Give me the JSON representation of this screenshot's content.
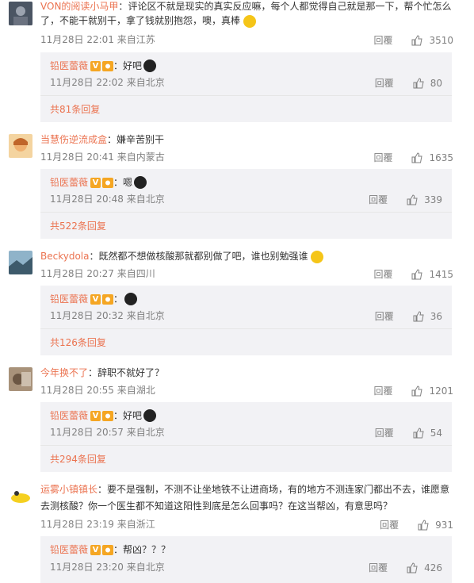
{
  "comments": [
    {
      "username": "VON的阅读小马甲",
      "text_line1": "评论区不就是现实的真实反应嘛，每个人都觉得自己就是那一下，帮个忙怎么",
      "text_line2": "了，不能干就别干，拿了钱就别抱怨，噢，真棒",
      "time": "11月28日 22:01 来自江苏",
      "reply_label": "回覆",
      "likes": "3510",
      "reply": {
        "username": "铅医蕾薇",
        "text": "好吧",
        "time": "11月28日 22:02 来自北京",
        "reply_label": "回覆",
        "likes": "80"
      },
      "more": "共81条回复"
    },
    {
      "username": "当慧伤逆流成盒",
      "text_line1": "嫌辛苦别干",
      "time": "11月28日 20:41 来自内蒙古",
      "reply_label": "回覆",
      "likes": "1635",
      "reply": {
        "username": "铅医蕾薇",
        "text": "嗯",
        "time": "11月28日 20:48 来自北京",
        "reply_label": "回覆",
        "likes": "339"
      },
      "more": "共522条回复"
    },
    {
      "username": "Beckydola",
      "text_line1": "既然都不想做核酸那就都别做了吧，谁也别勉强谁",
      "time": "11月28日 20:27 来自四川",
      "reply_label": "回覆",
      "likes": "1415",
      "reply": {
        "username": "铅医蕾薇",
        "text": "",
        "time": "11月28日 20:32 来自北京",
        "reply_label": "回覆",
        "likes": "36"
      },
      "more": "共126条回复"
    },
    {
      "username": "今年换不了",
      "text_line1": "辞职不就好了？",
      "time": "11月28日 20:55 来自湖北",
      "reply_label": "回覆",
      "likes": "1201",
      "reply": {
        "username": "铅医蕾薇",
        "text": "好吧",
        "time": "11月28日 20:57 来自北京",
        "reply_label": "回覆",
        "likes": "54"
      },
      "more": "共294条回复"
    },
    {
      "username": "运雾小镇镇长",
      "text_line1": "要不是强制，不测不让坐地铁不让进商场，有的地方不测连家门都出不去，谁愿意",
      "text_line2": "去测核酸？你一个医生都不知道这阳性到底是怎么回事吗？在这当帮凶，有意思吗？",
      "time": "11月28日 23:19 来自浙江",
      "reply_label": "回覆",
      "likes": "931",
      "reply": {
        "username": "铅医蕾薇",
        "text": "帮凶？？？",
        "time": "11月28日 23:20 来自北京",
        "reply_label": "回覆",
        "likes": "426"
      }
    }
  ],
  "colors": {
    "accent": "#eb7350",
    "sub_bg": "#f2f2f5",
    "meta": "#808080"
  }
}
